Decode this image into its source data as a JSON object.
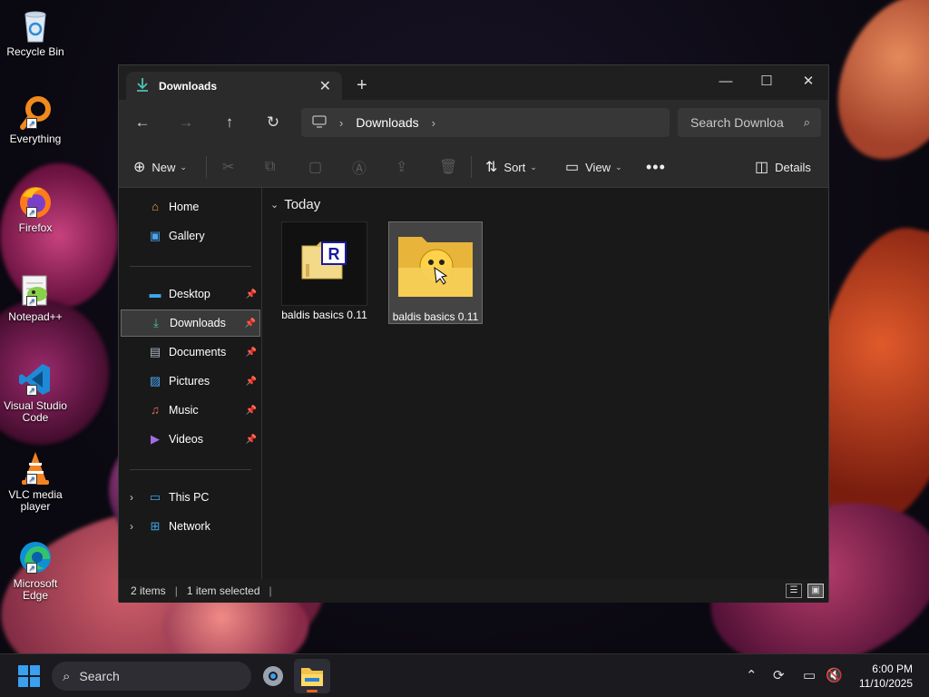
{
  "desktop": {
    "icons": [
      {
        "label": "Recycle Bin",
        "icon": "recycle-bin-icon"
      },
      {
        "label": "Everything",
        "icon": "everything-search-icon"
      },
      {
        "label": "Firefox",
        "icon": "firefox-icon"
      },
      {
        "label": "Notepad++",
        "icon": "notepad-plus-plus-icon"
      },
      {
        "label": "Visual Studio Code",
        "icon": "vscode-icon"
      },
      {
        "label": "VLC media player",
        "icon": "vlc-icon"
      },
      {
        "label": "Microsoft Edge",
        "icon": "edge-icon"
      }
    ]
  },
  "explorer": {
    "tab_title": "Downloads",
    "breadcrumb": {
      "current": "Downloads"
    },
    "search_placeholder": "Search Downloa",
    "toolbar": {
      "new_label": "New",
      "sort_label": "Sort",
      "view_label": "View",
      "details_label": "Details"
    },
    "nav": {
      "home": "Home",
      "gallery": "Gallery",
      "desktop": "Desktop",
      "downloads": "Downloads",
      "documents": "Documents",
      "pictures": "Pictures",
      "music": "Music",
      "videos": "Videos",
      "this_pc": "This PC",
      "network": "Network"
    },
    "group_header": "Today",
    "files": [
      {
        "name": "baldis basics 0.11",
        "type": "archive",
        "selected": false
      },
      {
        "name": "baldis basics 0.11",
        "type": "folder",
        "selected": true
      }
    ],
    "status": {
      "item_count": "2 items",
      "selection": "1 item selected"
    }
  },
  "taskbar": {
    "search_label": "Search",
    "time": "6:00 PM",
    "date": "11/10/2025"
  },
  "colors": {
    "accent": "#3aa0f0",
    "folder_yellow": "#f2c94c",
    "active_app_indicator": "#e9621f"
  }
}
